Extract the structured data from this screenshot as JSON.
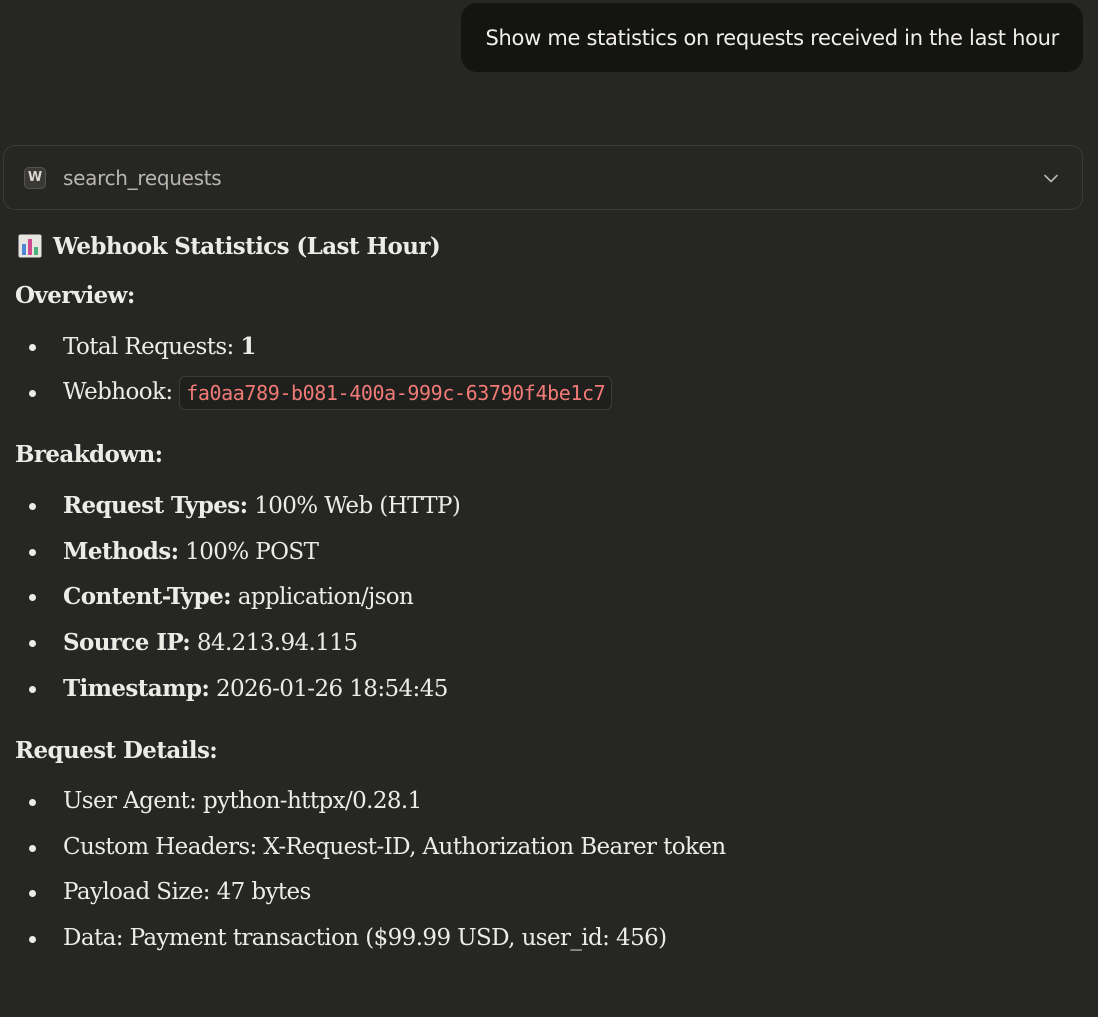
{
  "user_message": "Show me statistics on requests received in the last hour",
  "tool_call": {
    "logo_letter": "W",
    "name": "search_requests"
  },
  "response": {
    "title_icon": "bar-chart-emoji-icon",
    "title": "Webhook Statistics (Last Hour)",
    "overview": {
      "heading": "Overview:",
      "total_label": "Total Requests:",
      "total_value": "1",
      "webhook_label": "Webhook:",
      "webhook_id": "fa0aa789-b081-400a-999c-63790f4be1c7"
    },
    "breakdown": {
      "heading": "Breakdown:",
      "items": [
        {
          "key": "Request Types:",
          "value": "100% Web (HTTP)"
        },
        {
          "key": "Methods:",
          "value": "100% POST"
        },
        {
          "key": "Content-Type:",
          "value": "application/json"
        },
        {
          "key": "Source IP:",
          "value": "84.213.94.115"
        },
        {
          "key": "Timestamp:",
          "value": "2026-01-26 18:54:45"
        }
      ]
    },
    "details": {
      "heading": "Request Details:",
      "items": [
        "User Agent: python-httpx/0.28.1",
        "Custom Headers: X-Request-ID, Authorization Bearer token",
        "Payload Size: 47 bytes",
        "Data: Payment transaction ($99.99 USD, user_id: 456)"
      ]
    }
  }
}
